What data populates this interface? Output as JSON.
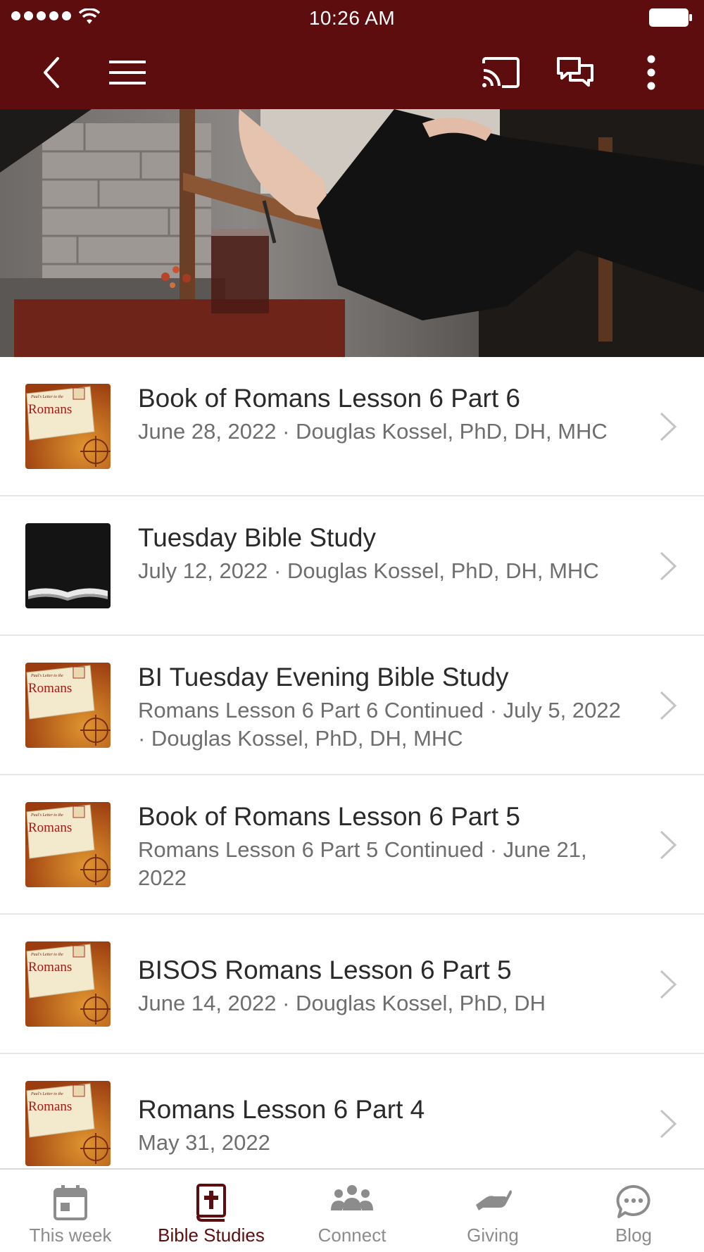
{
  "status_bar": {
    "time": "10:26 AM"
  },
  "nav": {
    "icons": [
      "back-icon",
      "menu-icon",
      "cast-icon",
      "chat-icon",
      "more-vertical-icon"
    ]
  },
  "list": [
    {
      "title": "Book of Romans Lesson 6 Part 6",
      "subtitle": "June 28, 2022 · Douglas Kossel, PhD, DH, MHC",
      "thumb": "romans",
      "thumb_top": "Paul's Letter to the",
      "thumb_title": "Romans"
    },
    {
      "title": "Tuesday Bible Study",
      "subtitle": "July 12, 2022 · Douglas Kossel, PhD, DH, MHC",
      "thumb": "bible"
    },
    {
      "title": "BI Tuesday Evening Bible Study",
      "subtitle": "Romans Lesson 6 Part 6 Continued · July 5, 2022 · Douglas Kossel, PhD, DH, MHC",
      "thumb": "romans",
      "thumb_top": "Paul's Letter to the",
      "thumb_title": "Romans"
    },
    {
      "title": "Book of Romans Lesson 6 Part 5",
      "subtitle": "Romans Lesson 6 Part 5 Continued · June 21, 2022",
      "thumb": "romans",
      "thumb_top": "Paul's Letter to the",
      "thumb_title": "Romans"
    },
    {
      "title": "BISOS Romans Lesson 6 Part 5",
      "subtitle": "June 14, 2022 · Douglas Kossel, PhD, DH",
      "thumb": "romans",
      "thumb_top": "Paul's Letter to the",
      "thumb_title": "Romans"
    },
    {
      "title": "Romans Lesson 6 Part 4",
      "subtitle": "May 31, 2022",
      "thumb": "romans",
      "thumb_top": "Paul's Letter to the",
      "thumb_title": "Romans"
    }
  ],
  "tabs": [
    {
      "label": "This week",
      "icon": "calendar-icon",
      "active": false
    },
    {
      "label": "Bible Studies",
      "icon": "bible-icon",
      "active": true
    },
    {
      "label": "Connect",
      "icon": "people-icon",
      "active": false
    },
    {
      "label": "Giving",
      "icon": "giving-hand-icon",
      "active": false
    },
    {
      "label": "Blog",
      "icon": "chat-bubble-icon",
      "active": false
    }
  ],
  "colors": {
    "brand": "#5e0d0f",
    "inactive_tab": "#8c8c8c",
    "text": "#2a2a2a",
    "subtext": "#6e6e6e"
  }
}
